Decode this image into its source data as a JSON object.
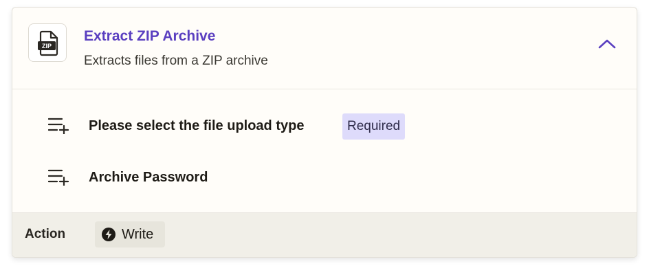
{
  "step": {
    "app_icon": "zip-file-icon",
    "app_icon_text": "ZIP",
    "title": "Extract ZIP Archive",
    "subtitle": "Extracts files from a ZIP archive",
    "collapse_icon": "chevron-up-icon"
  },
  "fields": [
    {
      "icon": "add-to-list-icon",
      "label": "Please select the file upload type",
      "badge": "Required"
    },
    {
      "icon": "add-to-list-icon",
      "label": "Archive Password"
    }
  ],
  "footer": {
    "label": "Action",
    "type_icon": "lightning-bolt-icon",
    "type_label": "Write"
  },
  "colors": {
    "title_accent": "#5a3fc0",
    "badge_bg": "#dedbfb",
    "footer_bg": "#f1efe8",
    "card_bg": "#fffdf9"
  }
}
